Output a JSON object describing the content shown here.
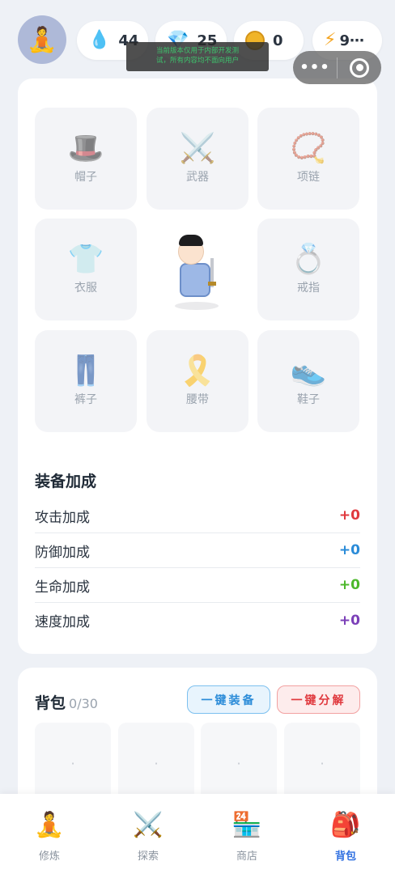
{
  "header": {
    "avatar_icon": "🧘",
    "resources": [
      {
        "name": "water",
        "icon": "💧",
        "value": "44"
      },
      {
        "name": "gem",
        "icon": "💎",
        "value": "25"
      },
      {
        "name": "coin",
        "icon": "coin-icon",
        "value": "0"
      },
      {
        "name": "energy",
        "icon": "⚡",
        "value": "9⋯"
      }
    ]
  },
  "notice": {
    "line1": "当前版本仅用于内部开发测",
    "line2": "试，所有内容均不面向用户"
  },
  "mini_program_capsule": {
    "more_label": "•••"
  },
  "equipment": {
    "slots": [
      {
        "label": "帽子",
        "icon": "🎩"
      },
      {
        "label": "武器",
        "icon": "⚔️"
      },
      {
        "label": "项链",
        "icon": "📿"
      },
      {
        "label": "衣服",
        "icon": "👕"
      },
      {
        "label": "戒指",
        "icon": "💍"
      },
      {
        "label": "裤子",
        "icon": "👖"
      },
      {
        "label": "腰带",
        "icon": "🎗️"
      },
      {
        "label": "鞋子",
        "icon": "👟"
      }
    ]
  },
  "stats": {
    "title": "装备加成",
    "rows": [
      {
        "label": "攻击加成",
        "value": "+0",
        "color": "#e0393e"
      },
      {
        "label": "防御加成",
        "value": "+0",
        "color": "#2a8bd8"
      },
      {
        "label": "生命加成",
        "value": "+0",
        "color": "#4cb82b"
      },
      {
        "label": "速度加成",
        "value": "+0",
        "color": "#7b3fb8"
      }
    ]
  },
  "bag": {
    "title": "背包",
    "count": "0/30",
    "equip_all_label": "一键装备",
    "decompose_all_label": "一键分解",
    "empty_marker": "·"
  },
  "tabbar": {
    "active_index": 3,
    "active_color": "#2f6fe0",
    "tabs": [
      {
        "label": "修炼",
        "icon": "🧘"
      },
      {
        "label": "探索",
        "icon": "⚔️"
      },
      {
        "label": "商店",
        "icon": "🏪"
      },
      {
        "label": "背包",
        "icon": "🎒"
      }
    ]
  }
}
